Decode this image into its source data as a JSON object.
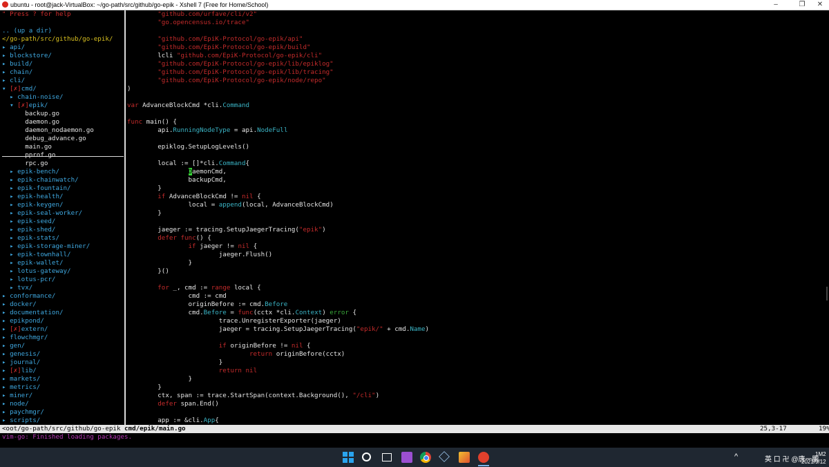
{
  "window": {
    "title": "ubuntu - root@jack-VirtualBox: ~/go-path/src/github/go-epik - Xshell 7 (Free for Home/School)",
    "minimize": "–",
    "maximize": "❐",
    "close": "✕"
  },
  "tree": [
    [
      {
        "t": "\" Press ? for help",
        "c": "red"
      }
    ],
    [
      {
        "t": "",
        "c": "file"
      }
    ],
    [
      {
        "t": ".. (up a dir)",
        "c": "dir"
      }
    ],
    [
      {
        "t": "</go-path/src/github/go-epik/",
        "c": "path"
      }
    ],
    [
      {
        "t": "▸ api/",
        "c": "dir"
      }
    ],
    [
      {
        "t": "▸ blockstore/",
        "c": "dir"
      }
    ],
    [
      {
        "t": "▸ build/",
        "c": "dir"
      }
    ],
    [
      {
        "t": "▸ chain/",
        "c": "dir"
      }
    ],
    [
      {
        "t": "▸ cli/",
        "c": "dir"
      }
    ],
    [
      {
        "t": "▾ ",
        "c": "dir"
      },
      {
        "t": "[✗]",
        "c": "red"
      },
      {
        "t": "cmd/",
        "c": "dir"
      }
    ],
    [
      {
        "t": "  ▸ chain-noise/",
        "c": "dir"
      }
    ],
    [
      {
        "t": "  ▾ ",
        "c": "dir"
      },
      {
        "t": "[✗]",
        "c": "red"
      },
      {
        "t": "epik/",
        "c": "dir"
      }
    ],
    [
      {
        "t": "      backup.go",
        "c": "file"
      }
    ],
    [
      {
        "t": "      daemon.go",
        "c": "file"
      }
    ],
    [
      {
        "t": "      daemon_nodaemon.go",
        "c": "file"
      }
    ],
    [
      {
        "t": "      debug_advance.go",
        "c": "file"
      }
    ],
    [
      {
        "t": "      main.go",
        "c": "file"
      }
    ],
    [
      {
        "t": "      pprof.go",
        "c": "file"
      }
    ],
    [
      {
        "t": "      rpc.go",
        "c": "file"
      }
    ],
    [
      {
        "t": "  ▸ epik-bench/",
        "c": "dir"
      }
    ],
    [
      {
        "t": "  ▸ epik-chainwatch/",
        "c": "dir"
      }
    ],
    [
      {
        "t": "  ▸ epik-fountain/",
        "c": "dir"
      }
    ],
    [
      {
        "t": "  ▸ epik-health/",
        "c": "dir"
      }
    ],
    [
      {
        "t": "  ▸ epik-keygen/",
        "c": "dir"
      }
    ],
    [
      {
        "t": "  ▸ epik-seal-worker/",
        "c": "dir"
      }
    ],
    [
      {
        "t": "  ▸ epik-seed/",
        "c": "dir"
      }
    ],
    [
      {
        "t": "  ▸ epik-shed/",
        "c": "dir"
      }
    ],
    [
      {
        "t": "  ▸ epik-stats/",
        "c": "dir"
      }
    ],
    [
      {
        "t": "  ▸ epik-storage-miner/",
        "c": "dir"
      }
    ],
    [
      {
        "t": "  ▸ epik-townhall/",
        "c": "dir"
      }
    ],
    [
      {
        "t": "  ▸ epik-wallet/",
        "c": "dir"
      }
    ],
    [
      {
        "t": "  ▸ lotus-gateway/",
        "c": "dir"
      }
    ],
    [
      {
        "t": "  ▸ lotus-pcr/",
        "c": "dir"
      }
    ],
    [
      {
        "t": "  ▸ tvx/",
        "c": "dir"
      }
    ],
    [
      {
        "t": "▸ conformance/",
        "c": "dir"
      }
    ],
    [
      {
        "t": "▸ docker/",
        "c": "dir"
      }
    ],
    [
      {
        "t": "▸ documentation/",
        "c": "dir"
      }
    ],
    [
      {
        "t": "▸ epikpond/",
        "c": "dir"
      }
    ],
    [
      {
        "t": "▸ ",
        "c": "dir"
      },
      {
        "t": "[✗]",
        "c": "red"
      },
      {
        "t": "extern/",
        "c": "dir"
      }
    ],
    [
      {
        "t": "▸ flowchmgr/",
        "c": "dir"
      }
    ],
    [
      {
        "t": "▸ gen/",
        "c": "dir"
      }
    ],
    [
      {
        "t": "▸ genesis/",
        "c": "dir"
      }
    ],
    [
      {
        "t": "▸ journal/",
        "c": "dir"
      }
    ],
    [
      {
        "t": "▸ ",
        "c": "dir"
      },
      {
        "t": "[✗]",
        "c": "red"
      },
      {
        "t": "lib/",
        "c": "dir"
      }
    ],
    [
      {
        "t": "▸ markets/",
        "c": "dir"
      }
    ],
    [
      {
        "t": "▸ metrics/",
        "c": "dir"
      }
    ],
    [
      {
        "t": "▸ miner/",
        "c": "dir"
      }
    ],
    [
      {
        "t": "▸ node/",
        "c": "dir"
      }
    ],
    [
      {
        "t": "▸ paychmgr/",
        "c": "dir"
      }
    ],
    [
      {
        "t": "▸ scripts/",
        "c": "dir"
      }
    ]
  ],
  "code": [
    [
      {
        "t": "        "
      },
      {
        "t": "\"github.com/urfave/cli/v2\"",
        "c": "str"
      }
    ],
    [
      {
        "t": "        "
      },
      {
        "t": "\"go.opencensus.io/trace\"",
        "c": "str"
      }
    ],
    [
      {
        "t": ""
      }
    ],
    [
      {
        "t": "        "
      },
      {
        "t": "\"github.com/EpiK-Protocol/go-epik/api\"",
        "c": "str"
      }
    ],
    [
      {
        "t": "        "
      },
      {
        "t": "\"github.com/EpiK-Protocol/go-epik/build\"",
        "c": "str"
      }
    ],
    [
      {
        "t": "        lcli "
      },
      {
        "t": "\"github.com/EpiK-Protocol/go-epik/cli\"",
        "c": "str"
      }
    ],
    [
      {
        "t": "        "
      },
      {
        "t": "\"github.com/EpiK-Protocol/go-epik/lib/epiklog\"",
        "c": "str"
      }
    ],
    [
      {
        "t": "        "
      },
      {
        "t": "\"github.com/EpiK-Protocol/go-epik/lib/tracing\"",
        "c": "str"
      }
    ],
    [
      {
        "t": "        "
      },
      {
        "t": "\"github.com/EpiK-Protocol/go-epik/node/repo\"",
        "c": "str"
      }
    ],
    [
      {
        "t": ")"
      }
    ],
    [
      {
        "t": ""
      }
    ],
    [
      {
        "t": "var",
        "c": "kw"
      },
      {
        "t": " AdvanceBlockCmd *cli."
      },
      {
        "t": "Command",
        "c": "type"
      }
    ],
    [
      {
        "t": ""
      }
    ],
    [
      {
        "t": "func",
        "c": "kw"
      },
      {
        "t": " main() {"
      }
    ],
    [
      {
        "t": "        api."
      },
      {
        "t": "RunningNodeType",
        "c": "type"
      },
      {
        "t": " = api."
      },
      {
        "t": "NodeFull",
        "c": "type"
      }
    ],
    [
      {
        "t": ""
      }
    ],
    [
      {
        "t": "        epiklog.SetupLogLevels()"
      }
    ],
    [
      {
        "t": ""
      }
    ],
    [
      {
        "t": "        local := []*cli."
      },
      {
        "t": "Command",
        "c": "type"
      },
      {
        "t": "{"
      }
    ],
    [
      {
        "t": "                "
      },
      {
        "t": "D",
        "c": "cur"
      },
      {
        "t": "aemonCmd,"
      }
    ],
    [
      {
        "t": "                backupCmd,"
      }
    ],
    [
      {
        "t": "        }"
      }
    ],
    [
      {
        "t": "        "
      },
      {
        "t": "if",
        "c": "kw"
      },
      {
        "t": " AdvanceBlockCmd != "
      },
      {
        "t": "nil",
        "c": "kw"
      },
      {
        "t": " {"
      }
    ],
    [
      {
        "t": "                local = "
      },
      {
        "t": "append",
        "c": "type"
      },
      {
        "t": "(local, AdvanceBlockCmd)"
      }
    ],
    [
      {
        "t": "        }"
      }
    ],
    [
      {
        "t": ""
      }
    ],
    [
      {
        "t": "        jaeger := tracing.SetupJaegerTracing("
      },
      {
        "t": "\"epik\"",
        "c": "str"
      },
      {
        "t": ")"
      }
    ],
    [
      {
        "t": "        "
      },
      {
        "t": "defer",
        "c": "kw"
      },
      {
        "t": " "
      },
      {
        "t": "func",
        "c": "kw"
      },
      {
        "t": "() {"
      }
    ],
    [
      {
        "t": "                "
      },
      {
        "t": "if",
        "c": "kw"
      },
      {
        "t": " jaeger != "
      },
      {
        "t": "nil",
        "c": "kw"
      },
      {
        "t": " {"
      }
    ],
    [
      {
        "t": "                        jaeger.Flush()"
      }
    ],
    [
      {
        "t": "                }"
      }
    ],
    [
      {
        "t": "        }()"
      }
    ],
    [
      {
        "t": ""
      }
    ],
    [
      {
        "t": "        "
      },
      {
        "t": "for",
        "c": "kw"
      },
      {
        "t": " _, cmd := "
      },
      {
        "t": "range",
        "c": "kw"
      },
      {
        "t": " local {"
      }
    ],
    [
      {
        "t": "                cmd := cmd"
      }
    ],
    [
      {
        "t": "                originBefore := cmd."
      },
      {
        "t": "Before",
        "c": "type"
      }
    ],
    [
      {
        "t": "                cmd."
      },
      {
        "t": "Before",
        "c": "type"
      },
      {
        "t": " = "
      },
      {
        "t": "func",
        "c": "kw"
      },
      {
        "t": "(cctx *cli."
      },
      {
        "t": "Context",
        "c": "type"
      },
      {
        "t": ") "
      },
      {
        "t": "error",
        "c": "grn"
      },
      {
        "t": " {"
      }
    ],
    [
      {
        "t": "                        trace.UnregisterExporter(jaeger)"
      }
    ],
    [
      {
        "t": "                        jaeger = tracing.SetupJaegerTracing("
      },
      {
        "t": "\"epik/\"",
        "c": "str"
      },
      {
        "t": " + cmd."
      },
      {
        "t": "Name",
        "c": "type"
      },
      {
        "t": ")"
      }
    ],
    [
      {
        "t": ""
      }
    ],
    [
      {
        "t": "                        "
      },
      {
        "t": "if",
        "c": "kw"
      },
      {
        "t": " originBefore != "
      },
      {
        "t": "nil",
        "c": "kw"
      },
      {
        "t": " {"
      }
    ],
    [
      {
        "t": "                                "
      },
      {
        "t": "return",
        "c": "kw"
      },
      {
        "t": " originBefore(cctx)"
      }
    ],
    [
      {
        "t": "                        }"
      }
    ],
    [
      {
        "t": "                        "
      },
      {
        "t": "return",
        "c": "kw"
      },
      {
        "t": " "
      },
      {
        "t": "nil",
        "c": "kw"
      }
    ],
    [
      {
        "t": "                }"
      }
    ],
    [
      {
        "t": "        }"
      }
    ],
    [
      {
        "t": "        ctx, span := trace.StartSpan(context.Background(), "
      },
      {
        "t": "\"/cli\"",
        "c": "str"
      },
      {
        "t": ")"
      }
    ],
    [
      {
        "t": "        "
      },
      {
        "t": "defer",
        "c": "kw"
      },
      {
        "t": " span.End()"
      }
    ],
    [
      {
        "t": ""
      }
    ],
    [
      {
        "t": "        app := &cli."
      },
      {
        "t": "App",
        "c": "type"
      },
      {
        "t": "{"
      }
    ]
  ],
  "status": {
    "tree_path": "<oot/go-path/src/github/go-epik",
    "file": "cmd/epik/main.go",
    "position": "25,3-17",
    "percent": "19%"
  },
  "message": "vim-go: Finished loading packages.",
  "taskbar": {
    "tray_chevron": "^",
    "tray_text": "英 口 卍 @唐一鹏",
    "time": "1M2",
    "date": "2021/9/12"
  }
}
